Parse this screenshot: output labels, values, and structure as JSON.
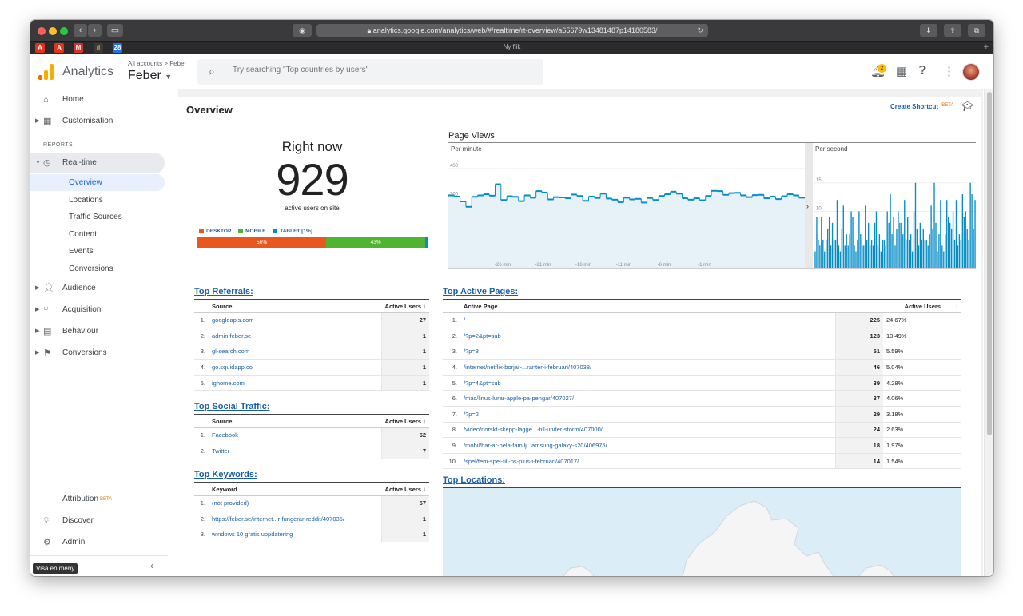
{
  "browser": {
    "url": "analytics.google.com/analytics/web/#/realtime/rt-overview/a65679w13481487p14180583/",
    "tab_title": "Ny flik"
  },
  "header": {
    "app_title": "Analytics",
    "account_crumb_all": "All accounts",
    "account_crumb_sep": ">",
    "account_crumb_prop": "Feber",
    "account_name": "Feber",
    "search_placeholder": "Try searching \"Top countries by users\"",
    "notification_count": "2"
  },
  "sidebar": {
    "home": "Home",
    "customisation": "Customisation",
    "reports_section": "REPORTS",
    "realtime": "Real-time",
    "realtime_items": [
      "Overview",
      "Locations",
      "Traffic Sources",
      "Content",
      "Events",
      "Conversions"
    ],
    "audience": "Audience",
    "acquisition": "Acquisition",
    "behaviour": "Behaviour",
    "conversions": "Conversions",
    "attribution": "Attribution",
    "attribution_badge": "BETA",
    "discover": "Discover",
    "admin": "Admin",
    "tooltip": "Visa en meny"
  },
  "overview": {
    "title": "Overview",
    "create_shortcut": "Create Shortcut",
    "shortcut_badge": "BETA",
    "right_now_label": "Right now",
    "active_users": "929",
    "active_users_caption": "active users on site",
    "devices": [
      {
        "name": "DESKTOP",
        "label": "56%",
        "share": 56,
        "color": "#e8571e"
      },
      {
        "name": "MOBILE",
        "label": "43%",
        "share": 43,
        "color": "#50b432"
      },
      {
        "name": "TABLET [1%]",
        "label": "",
        "share": 1,
        "color": "#058dc7"
      }
    ]
  },
  "page_views": {
    "title": "Page Views",
    "per_minute_label": "Per minute",
    "per_second_label": "Per second"
  },
  "chart_data": [
    {
      "type": "bar",
      "title": "Per minute",
      "ylim": [
        50,
        450
      ],
      "y_ticks": [
        "400",
        "300",
        "200",
        "100"
      ],
      "x_ticks": [
        "-26 min",
        "-21 min",
        "-16 min",
        "-11 min",
        "-6 min",
        "-1 min"
      ],
      "values": [
        306,
        302,
        285,
        266,
        301,
        306,
        310,
        305,
        345,
        290,
        303,
        301,
        286,
        306,
        298,
        321,
        316,
        292,
        300,
        299,
        296,
        309,
        304,
        287,
        302,
        297,
        312,
        295,
        291,
        282,
        298,
        292,
        294,
        281,
        297,
        290,
        304,
        310,
        319,
        312,
        296,
        291,
        296,
        289,
        304,
        322,
        321,
        308,
        314,
        315,
        306,
        300,
        307,
        308,
        296,
        302,
        293,
        303,
        310,
        306,
        298
      ]
    },
    {
      "type": "bar",
      "title": "Per second",
      "ylim": [
        0,
        20
      ],
      "y_ticks": [
        "15",
        "10",
        "5"
      ],
      "values": [
        3,
        9,
        5,
        4,
        9,
        5,
        3,
        5,
        7,
        9,
        4,
        8,
        5,
        5,
        12,
        4,
        3,
        7,
        11,
        4,
        6,
        4,
        6,
        10,
        9,
        4,
        3,
        5,
        10,
        6,
        4,
        4,
        11,
        5,
        8,
        4,
        5,
        4,
        8,
        10,
        4,
        6,
        3,
        5,
        5,
        4,
        10,
        8,
        13,
        6,
        9,
        4,
        7,
        10,
        8,
        8,
        6,
        12,
        5,
        9,
        5,
        6,
        3,
        10,
        15,
        7,
        4,
        8,
        5,
        7,
        5,
        5,
        4,
        6,
        11,
        7,
        15,
        8,
        3,
        6,
        12,
        4,
        3,
        6,
        12,
        9,
        8,
        7,
        10,
        5,
        12,
        4,
        6,
        5,
        13,
        9,
        10,
        7,
        5,
        15,
        13,
        7,
        12
      ]
    }
  ],
  "referrals": {
    "title": "Top Referrals:",
    "col_source": "Source",
    "col_users": "Active Users",
    "rows": [
      {
        "i": "1.",
        "name": "googleapis.com",
        "users": "27"
      },
      {
        "i": "2.",
        "name": "admin.feber.se",
        "users": "1"
      },
      {
        "i": "3.",
        "name": "gl-search.com",
        "users": "1"
      },
      {
        "i": "4.",
        "name": "go.squidapp.co",
        "users": "1"
      },
      {
        "i": "5.",
        "name": "ighome.com",
        "users": "1"
      }
    ]
  },
  "social": {
    "title": "Top Social Traffic:",
    "col_source": "Source",
    "col_users": "Active Users",
    "rows": [
      {
        "i": "1.",
        "name": "Facebook",
        "users": "52"
      },
      {
        "i": "2.",
        "name": "Twitter",
        "users": "7"
      }
    ]
  },
  "keywords": {
    "title": "Top Keywords:",
    "col_keyword": "Keyword",
    "col_users": "Active Users",
    "rows": [
      {
        "i": "1.",
        "name": "(not provided)",
        "users": "57"
      },
      {
        "i": "2.",
        "name": "https://feber.se/internet...r-fungerar-reddit/407035/",
        "users": "1"
      },
      {
        "i": "3.",
        "name": "windows 10 gratis uppdatering",
        "users": "1"
      }
    ]
  },
  "active_pages": {
    "title": "Top Active Pages:",
    "col_page": "Active Page",
    "col_users": "Active Users",
    "rows": [
      {
        "i": "1.",
        "name": "/",
        "users": "225",
        "pct": "24.67%"
      },
      {
        "i": "2.",
        "name": "/?p=2&pt=sub",
        "users": "123",
        "pct": "13.49%"
      },
      {
        "i": "3.",
        "name": "/?p=3",
        "users": "51",
        "pct": "5.59%"
      },
      {
        "i": "4.",
        "name": "/internet/netflix-borjar-...ranter-i-februari/407038/",
        "users": "46",
        "pct": "5.04%"
      },
      {
        "i": "5.",
        "name": "/?p=4&pt=sub",
        "users": "39",
        "pct": "4.28%"
      },
      {
        "i": "6.",
        "name": "/mac/linus-lurar-apple-pa-pengar/407027/",
        "users": "37",
        "pct": "4.06%"
      },
      {
        "i": "7.",
        "name": "/?p=2",
        "users": "29",
        "pct": "3.18%"
      },
      {
        "i": "8.",
        "name": "/video/norskt-skepp-lagge...-till-under-storm/407000/",
        "users": "24",
        "pct": "2.63%"
      },
      {
        "i": "9.",
        "name": "/mobil/har-ar-hela-familj...amsung-galaxy-s20/406975/",
        "users": "18",
        "pct": "1.97%"
      },
      {
        "i": "10.",
        "name": "/spel/fem-spel-till-ps-plus-i-februari/407017/",
        "users": "14",
        "pct": "1.54%"
      }
    ]
  },
  "locations": {
    "title": "Top Locations:"
  },
  "colors": {
    "accent": "#1a73e8",
    "link": "#1a5fa5",
    "chart_bar": "#058dc7",
    "chart_fill": "#e6f1f8"
  }
}
